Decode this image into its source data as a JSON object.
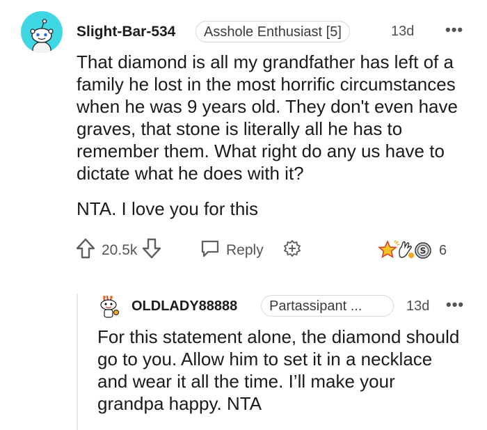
{
  "comment": {
    "username": "Slight-Bar-534",
    "flair": "Asshole Enthusiast [5]",
    "age": "13d",
    "menu": "•••",
    "paragraphs": [
      "That diamond is all my grandfather has left of a family he lost in the most horrific circumstances when he was 9 years old. They don't even have graves, that stone is literally all he has to remember them. What right do any us have to dictate what he does with it?",
      "NTA. I love you for this"
    ],
    "actions": {
      "score": "20.5k",
      "reply_label": "Reply",
      "award_count": "6"
    }
  },
  "reply": {
    "username": "OLDLADY88888",
    "flair": "Partassipant ...",
    "age": "13d",
    "menu": "•••",
    "text": "For this statement alone, the diamond should go to you. Allow him to set it in a necklace and wear it all the time. I’ll make your grandpa happy. NTA"
  },
  "colors": {
    "avatar_bg": "#3fd7e4",
    "icon_gray": "#5f5f5f"
  }
}
